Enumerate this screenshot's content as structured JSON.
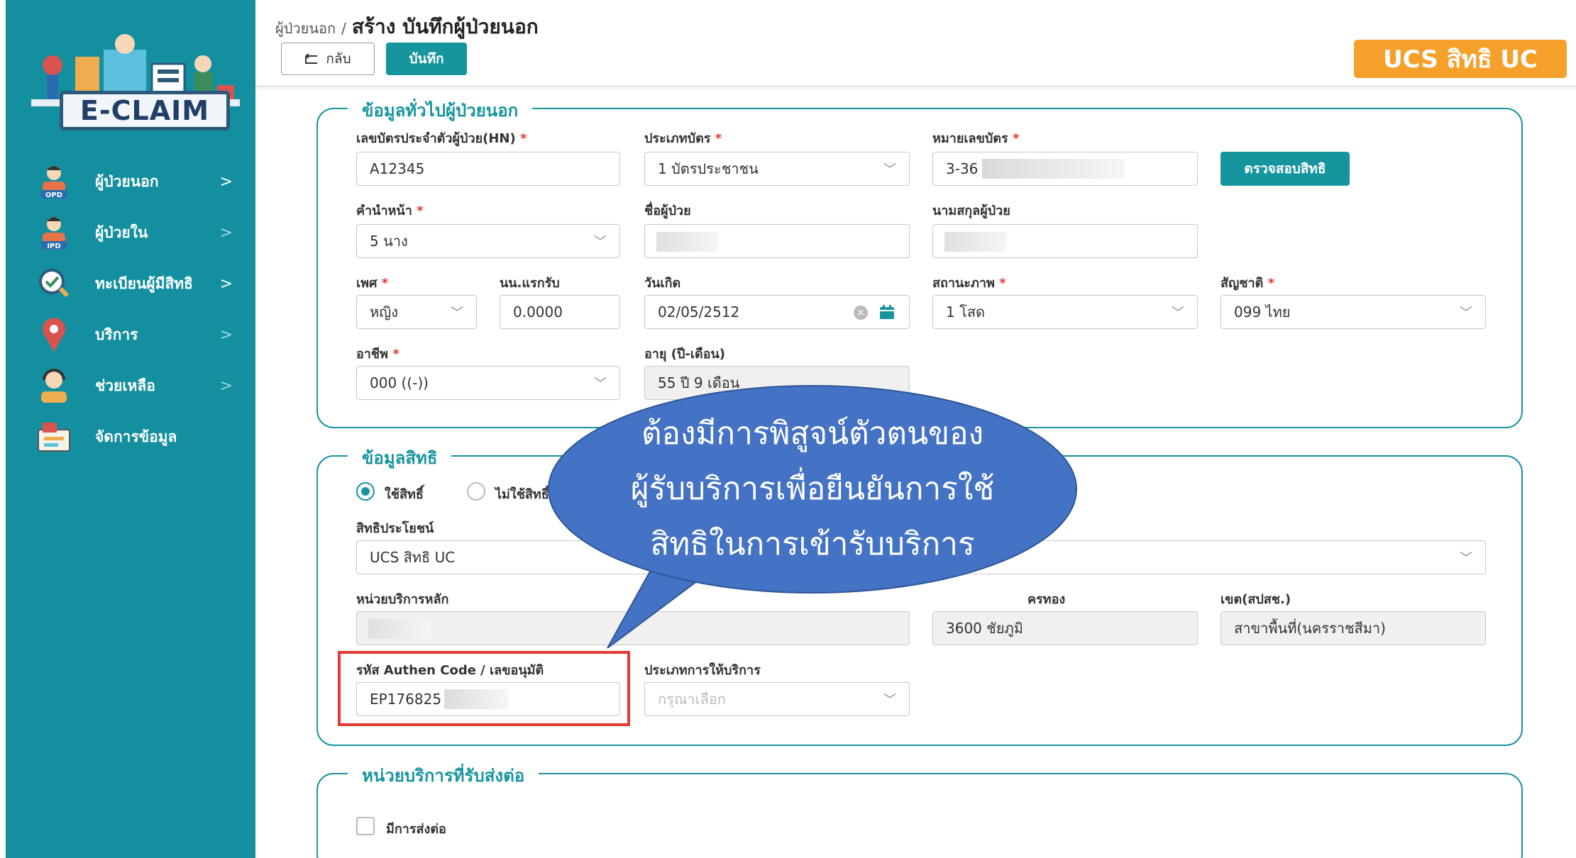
{
  "sidebar": {
    "logo_text": "E-CLAIM",
    "items": [
      {
        "label": "ผู้ป่วยนอก",
        "icon": "opd-patient-icon",
        "tag": "OPD"
      },
      {
        "label": "ผู้ป่วยใน",
        "icon": "ipd-patient-icon",
        "tag": "IPD"
      },
      {
        "label": "ทะเบียนผู้มีสิทธิ",
        "icon": "registry-check-icon"
      },
      {
        "label": "บริการ",
        "icon": "map-pin-icon"
      },
      {
        "label": "ช่วยเหลือ",
        "icon": "support-agent-icon"
      },
      {
        "label": "จัดการข้อมูล",
        "icon": "data-management-icon"
      }
    ]
  },
  "header": {
    "breadcrumb_parent": "ผู้ป่วยนอก",
    "breadcrumb_sep": "/",
    "title": "สร้าง บันทึกผู้ป่วยนอก",
    "back_label": "กลับ",
    "save_label": "บันทึก",
    "rights_badge": "UCS สิทธิ UC"
  },
  "general": {
    "title": "ข้อมูลทั่วไปผู้ป่วยนอก",
    "hn_label": "เลขบัตรประจำตัวผู้ป่วย(HN)",
    "hn_value": "A12345",
    "card_type_label": "ประเภทบัตร",
    "card_type_value": "1 บัตรประชาชน",
    "card_no_label": "หมายเลขบัตร",
    "card_no_value": "3-36",
    "check_rights_button": "ตรวจสอบสิทธิ",
    "prefix_label": "คำนำหน้า",
    "prefix_value": "5 นาง",
    "first_name_label": "ชื่อผู้ป่วย",
    "last_name_label": "นามสกุลผู้ป่วย",
    "sex_label": "เพศ",
    "sex_value": "หญิง",
    "weight_label": "นน.แรกรับ",
    "weight_value": "0.0000",
    "birth_label": "วันเกิด",
    "birth_value": "02/05/2512",
    "marital_label": "สถานะภาพ",
    "marital_value": "1 โสด",
    "nationality_label": "สัญชาติ",
    "nationality_value": "099 ไทย",
    "occupation_label": "อาชีพ",
    "occupation_value": "000 ((-))",
    "age_label": "อายุ (ปี-เดือน)",
    "age_value": "55 ปี 9 เดือน"
  },
  "rights": {
    "title": "ข้อมูลสิทธิ",
    "use_rights": "ใช้สิทธิ์",
    "no_rights": "ไม่ใช้สิทธิ์",
    "benefit_label": "สิทธิประโยชน์",
    "benefit_value": "UCS สิทธิ UC",
    "main_unit_label": "หน่วยบริการหลัก",
    "gold_card_label_tail": "ครทอง",
    "gold_card_value": "3600 ชัยภูมิ",
    "region_label": "เขต(สปสช.)",
    "region_value": "สาขาพื้นที่(นครราชสีมา)",
    "authen_label": "รหัส Authen Code / เลขอนุมัติ",
    "authen_value": "EP176825",
    "service_type_label": "ประเภทการให้บริการ",
    "service_type_placeholder": "กรุณาเลือก"
  },
  "referral": {
    "title": "หน่วยบริการที่รับส่งต่อ",
    "has_referral": "มีการส่งต่อ"
  },
  "callout": {
    "line1": "ต้องมีการพิสูจน์ตัวตนของ",
    "line2": "ผู้รับบริการเพื่อยืนยันการใช้",
    "line3": "สิทธิในการเข้ารับบริการ"
  },
  "colors": {
    "sidebar": "#138f9f",
    "accent": "#17959f",
    "badge": "#f6a02c",
    "required": "#e53935",
    "callout": "#4472c4"
  }
}
